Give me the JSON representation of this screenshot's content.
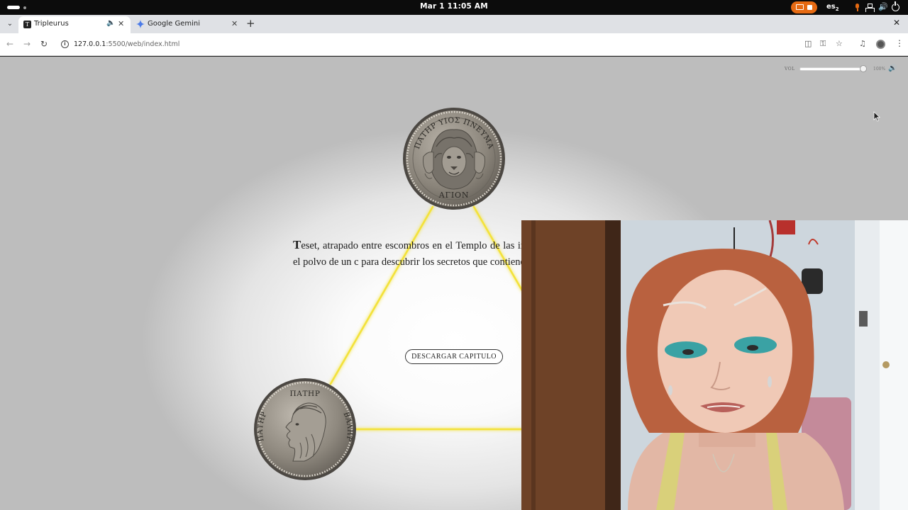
{
  "system_bar": {
    "clock": "Mar 1  11:05 AM",
    "input_language": "es",
    "input_language_index": "2"
  },
  "browser": {
    "tabs": [
      {
        "title": "Tripleurus",
        "favicon": "T",
        "active": true,
        "playing_audio": true
      },
      {
        "title": "Google Gemini",
        "favicon": "gemini-star",
        "active": false
      }
    ],
    "address": {
      "host": "127.0.0.1",
      "rest": ":5500/web/index.html"
    }
  },
  "page": {
    "volume": {
      "label": "VOL",
      "value_text": "100%",
      "level": 1.0
    },
    "coins": {
      "top_inscription": "ΠΑΤΗΡ ΥΙΟΣ ΠΝΕΥΜΑ",
      "top_bottom_inscription": "ΑΓΙΟΝ",
      "left_inscription_top": "ΠΑΤΗΡ",
      "left_inscription_left": "ΠΑΤΗΡ",
      "left_inscription_right": "ΒΑΛΗΡ"
    },
    "chapter_text": "Teset, atrapado entre escombros en el Templo de las indignación y, apresurado, limpia y sopla el polvo de un c para descubrir los secretos que contiene.",
    "download_button": "DESCARGAR CAPITULO"
  },
  "colors": {
    "glow_line": "#f3e23a",
    "recording": "#e66a12",
    "page_bg": "#ffffff"
  }
}
